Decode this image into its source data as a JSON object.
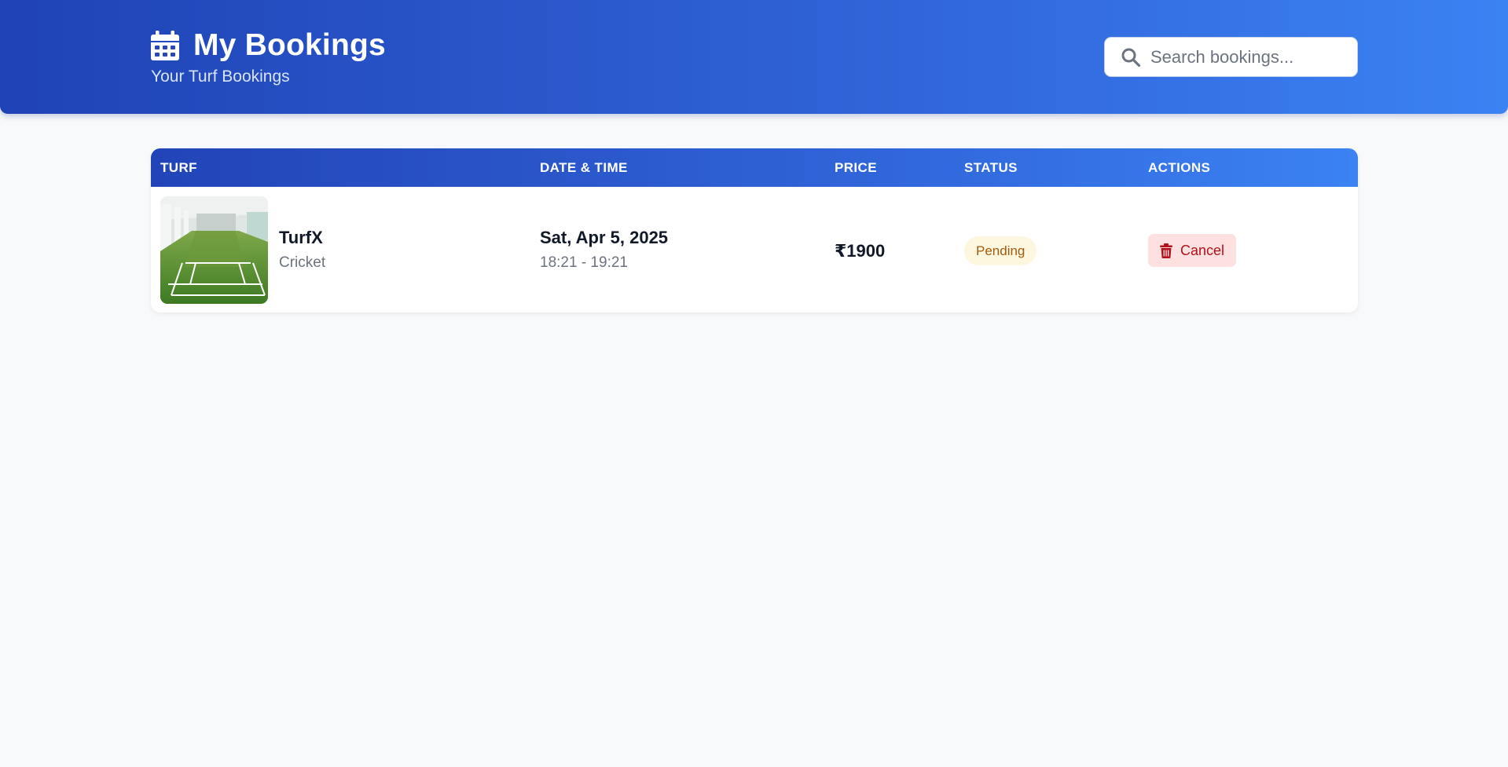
{
  "header": {
    "title": "My Bookings",
    "subtitle": "Your Turf Bookings",
    "icon": "calendar-icon",
    "search_placeholder": "Search bookings...",
    "search_value": ""
  },
  "table": {
    "columns": [
      "TURF",
      "DATE & TIME",
      "PRICE",
      "STATUS",
      "ACTIONS"
    ],
    "rows": [
      {
        "turf_name": "TurfX",
        "sport": "Cricket",
        "date": "Sat, Apr 5, 2025",
        "time": "18:21 - 19:21",
        "price": "₹1900",
        "status": "Pending",
        "action_label": "Cancel",
        "action_icon": "trash-icon"
      }
    ]
  },
  "colors": {
    "header_gradient_start": "#1f43b6",
    "header_gradient_end": "#3b82f3",
    "status_pending_bg": "#fef7e0",
    "status_pending_text": "#a45a0c",
    "cancel_bg": "#fde0e0",
    "cancel_text": "#b3111a"
  }
}
